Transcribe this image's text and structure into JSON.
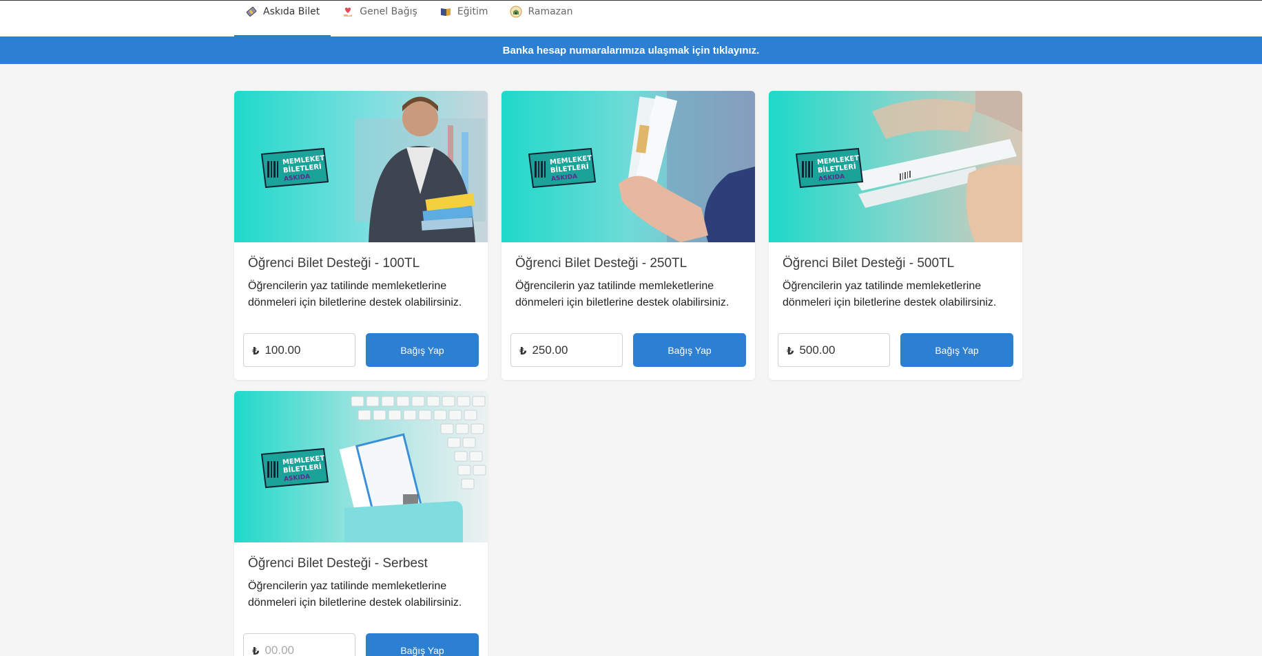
{
  "tabs": [
    {
      "label": "Askıda Bilet",
      "icon": "ticket-icon",
      "active": true
    },
    {
      "label": "Genel Bağış",
      "icon": "heart-hand-icon",
      "active": false
    },
    {
      "label": "Eğitim",
      "icon": "book-icon",
      "active": false
    },
    {
      "label": "Ramazan",
      "icon": "mosque-icon",
      "active": false
    }
  ],
  "banner": {
    "text": "Banka hesap numaralarımıza ulaşmak için tıklayınız."
  },
  "currency_symbol": "₺",
  "cards": [
    {
      "title": "Öğrenci Bilet Desteği - 100TL",
      "description": "Öğrencilerin yaz tatilinde memleketlerine dönmeleri için biletlerine destek olabilirsiniz.",
      "amount": "100.00",
      "placeholder": "",
      "button": "Bağış Yap",
      "image_label": [
        "MEMLEKET",
        "BİLETLERİ",
        "ASKIDA"
      ]
    },
    {
      "title": "Öğrenci Bilet Desteği - 250TL",
      "description": "Öğrencilerin yaz tatilinde memleketlerine dönmeleri için biletlerine destek olabilirsiniz.",
      "amount": "250.00",
      "placeholder": "",
      "button": "Bağış Yap",
      "image_label": [
        "MEMLEKET",
        "BİLETLERİ",
        "ASKIDA"
      ]
    },
    {
      "title": "Öğrenci Bilet Desteği - 500TL",
      "description": "Öğrencilerin yaz tatilinde memleketlerine dönmeleri için biletlerine destek olabilirsiniz.",
      "amount": "500.00",
      "placeholder": "",
      "button": "Bağış Yap",
      "image_label": [
        "MEMLEKET",
        "BİLETLERİ",
        "ASKIDA"
      ]
    },
    {
      "title": "Öğrenci Bilet Desteği - Serbest",
      "description": "Öğrencilerin yaz tatilinde memleketlerine dönmeleri için biletlerine destek olabilirsiniz.",
      "amount": "",
      "placeholder": "00.00",
      "button": "Bağış Yap",
      "image_label": [
        "MEMLEKET",
        "BİLETLERİ",
        "ASKIDA"
      ]
    }
  ],
  "colors": {
    "accent": "#2d7fd1",
    "teal": "#1ed9c9"
  }
}
